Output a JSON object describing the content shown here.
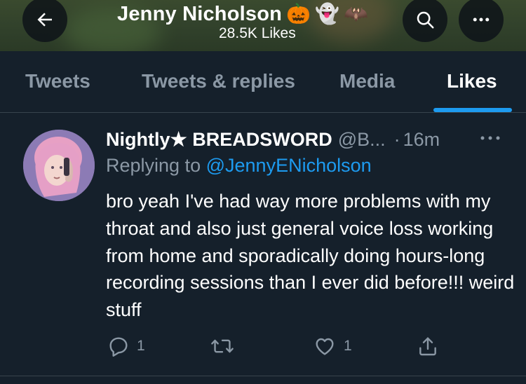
{
  "header": {
    "profile_name": "Jenny Nicholson",
    "name_emojis": [
      "🎃",
      "👻",
      "🦇"
    ],
    "likes_count": "28.5K Likes",
    "icons": {
      "back": "back-arrow-icon",
      "search": "search-icon",
      "more": "more-horizontal-icon"
    }
  },
  "tabs": [
    {
      "label": "Tweets",
      "active": false
    },
    {
      "label": "Tweets & replies",
      "active": false
    },
    {
      "label": "Media",
      "active": false
    },
    {
      "label": "Likes",
      "active": true
    }
  ],
  "tweet": {
    "display_name": "Nightly★ BREADSWORD",
    "handle": "@B...",
    "separator": "·",
    "time": "16m",
    "replying_prefix": "Replying to",
    "replying_to": "@JennyENicholson",
    "text": "bro yeah I've had way more problems with my throat and also just general voice loss working from home and sporadically doing hours-long recording sessions than I ever did before!!! weird stuff",
    "actions": {
      "reply_count": "1",
      "retweet_count": "",
      "like_count": "1"
    }
  },
  "colors": {
    "background": "#15202b",
    "accent": "#1d9bf0",
    "secondary_text": "#8b98a5",
    "divider": "#38444d"
  }
}
